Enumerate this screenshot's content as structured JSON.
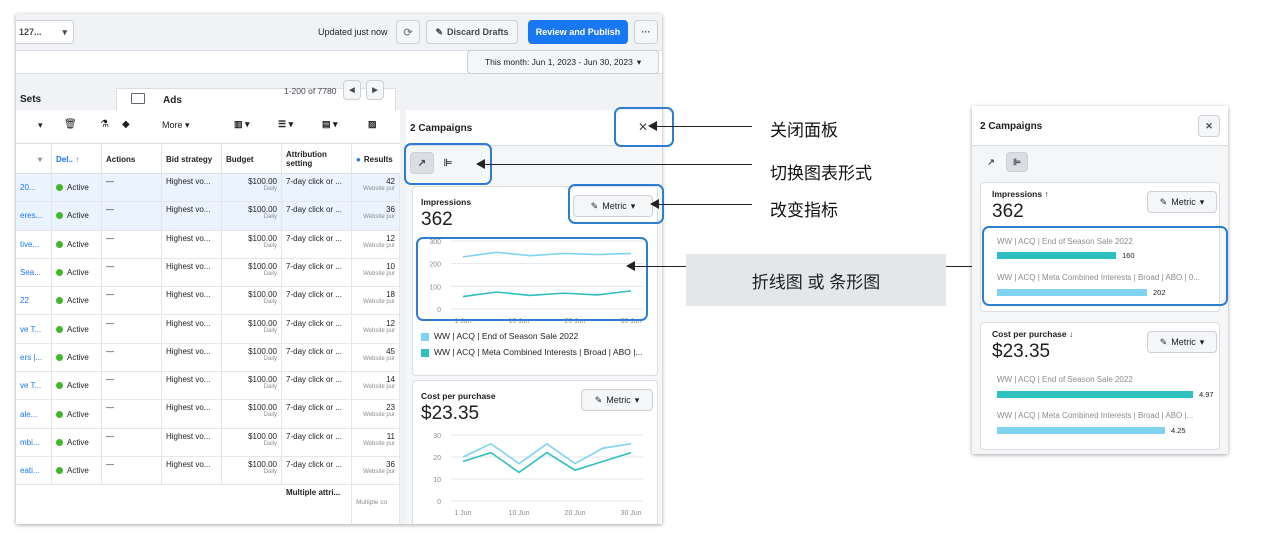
{
  "main": {
    "account_select": "127...",
    "updated_text": "Updated just now",
    "discard_label": "Discard Drafts",
    "publish_label": "Review and Publish",
    "more_label": "···",
    "date_range": "This month: Jun 1, 2023 - Jun 30, 2023",
    "tab_sets": "Sets",
    "tab_ads": "Ads",
    "pagination": "1-200 of 7780",
    "toolbar_more": "More",
    "columns": [
      "Del.. ↑",
      "Actions",
      "Bid strategy",
      "Budget",
      "Attribution setting",
      "Results"
    ],
    "rows": [
      {
        "name": "20...",
        "status": "Active",
        "actions": "—",
        "bid": "Highest vo...",
        "budget": "$100.00",
        "budget_sub": "Daily",
        "attr": "7-day click or ...",
        "result": "42",
        "result_sub": "Website pur"
      },
      {
        "name": "eres...",
        "status": "Active",
        "actions": "—",
        "bid": "Highest vo...",
        "budget": "$100.00",
        "budget_sub": "Daily",
        "attr": "7-day click or ...",
        "result": "36",
        "result_sub": "Website pur"
      },
      {
        "name": "tive...",
        "status": "Active",
        "actions": "—",
        "bid": "Highest vo...",
        "budget": "$100.00",
        "budget_sub": "Daily",
        "attr": "7-day click or ...",
        "result": "12",
        "result_sub": "Website pur"
      },
      {
        "name": "Sea...",
        "status": "Active",
        "actions": "—",
        "bid": "Highest vo...",
        "budget": "$100.00",
        "budget_sub": "Daily",
        "attr": "7-day click or ...",
        "result": "10",
        "result_sub": "Website pur"
      },
      {
        "name": "22",
        "status": "Active",
        "actions": "—",
        "bid": "Highest vo...",
        "budget": "$100.00",
        "budget_sub": "Daily",
        "attr": "7-day click or ...",
        "result": "18",
        "result_sub": "Website pur"
      },
      {
        "name": "ve T...",
        "status": "Active",
        "actions": "—",
        "bid": "Highest vo...",
        "budget": "$100.00",
        "budget_sub": "Daily",
        "attr": "7-day click or ...",
        "result": "12",
        "result_sub": "Website pur"
      },
      {
        "name": "ers |...",
        "status": "Active",
        "actions": "—",
        "bid": "Highest vo...",
        "budget": "$100.00",
        "budget_sub": "Daily",
        "attr": "7-day click or ...",
        "result": "45",
        "result_sub": "Website pur"
      },
      {
        "name": "ve T...",
        "status": "Active",
        "actions": "—",
        "bid": "Highest vo...",
        "budget": "$100.00",
        "budget_sub": "Daily",
        "attr": "7-day click or ...",
        "result": "14",
        "result_sub": "Website pur"
      },
      {
        "name": "ale...",
        "status": "Active",
        "actions": "—",
        "bid": "Highest vo...",
        "budget": "$100.00",
        "budget_sub": "Daily",
        "attr": "7-day click or ...",
        "result": "23",
        "result_sub": "Website pur"
      },
      {
        "name": "mbi...",
        "status": "Active",
        "actions": "—",
        "bid": "Highest vo...",
        "budget": "$100.00",
        "budget_sub": "Daily",
        "attr": "7-day click or ...",
        "result": "11",
        "result_sub": "Website pur"
      },
      {
        "name": "eati...",
        "status": "Active",
        "actions": "—",
        "bid": "Highest vo...",
        "budget": "$100.00",
        "budget_sub": "Daily",
        "attr": "7-day click or ...",
        "result": "36",
        "result_sub": "Website pur"
      }
    ],
    "summary_attr": "Multiple attri...",
    "summary_result": "Multiple co"
  },
  "panel": {
    "title": "2 Campaigns",
    "close": "✕",
    "metric_label": "Metric",
    "impressions_label": "Impressions",
    "impressions_value": "362",
    "cpp_label": "Cost per purchase",
    "cpp_value": "$23.35",
    "legend": [
      "WW | ACQ | End of Season Sale 2022",
      "WW | ACQ | Meta Combined Interests | Broad | ABO |..."
    ]
  },
  "chart_data": [
    {
      "type": "line",
      "title": "Impressions",
      "x": [
        "1 Jun",
        "10 Jun",
        "20 Jun",
        "30 Jun"
      ],
      "y_ticks": [
        0,
        100,
        200,
        300
      ],
      "ylim": [
        0,
        300
      ],
      "series": [
        {
          "name": "WW | ACQ | End of Season Sale 2022",
          "color": "#7fd3ef",
          "values": [
            230,
            250,
            235,
            245,
            240,
            245
          ]
        },
        {
          "name": "WW | ACQ | Meta Combined Interests | Broad | ABO |...",
          "color": "#2ebfbf",
          "values": [
            55,
            75,
            60,
            70,
            62,
            80
          ]
        }
      ]
    },
    {
      "type": "line",
      "title": "Cost per purchase",
      "x": [
        "1 Jun",
        "10 Jun",
        "20 Jun",
        "30 Jun"
      ],
      "y_ticks": [
        0,
        10,
        20,
        30
      ],
      "ylim": [
        0,
        30
      ],
      "series": [
        {
          "name": "WW | ACQ | End of Season Sale 2022",
          "color": "#7fd3ef",
          "values": [
            20,
            26,
            17,
            26,
            17,
            24,
            26
          ]
        },
        {
          "name": "WW | ACQ | Meta Combined Interests | Broad | ABO |...",
          "color": "#2ebfbf",
          "values": [
            18,
            22,
            13,
            22,
            14,
            18,
            22
          ]
        }
      ]
    },
    {
      "type": "bar",
      "title": "Impressions",
      "categories": [
        "WW | ACQ | End of Season Sale 2022",
        "WW | ACQ | Meta Combined Interests | Broad | ABO | 0..."
      ],
      "values": [
        160,
        202
      ]
    },
    {
      "type": "bar",
      "title": "Cost per purchase",
      "categories": [
        "WW | ACQ | End of Season Sale 2022",
        "WW | ACQ | Meta Combined Interests | Broad | ABO |..."
      ],
      "values": [
        4.97,
        4.25
      ]
    }
  ],
  "annotations": {
    "close_panel": "关闭面板",
    "switch_chart": "切换图表形式",
    "change_metric": "改变指标",
    "line_or_bar": "折线图 或 条形图"
  },
  "side": {
    "title": "2 Campaigns",
    "close": "✕",
    "impressions_label": "Impressions ↑",
    "impressions_value": "362",
    "cpp_label": "Cost per purchase ↓",
    "cpp_value": "$23.35",
    "metric_label": "Metric",
    "bar1_label": "WW | ACQ | End of Season Sale 2022",
    "bar2_label": "WW | ACQ | Meta Combined Interests | Broad | ABO | 0...",
    "bar3_label": "WW | ACQ | End of Season Sale 2022",
    "bar4_label": "WW | ACQ | Meta Combined Interests | Broad | ABO |...",
    "bar1_value": "160",
    "bar2_value": "202",
    "bar3_value": "4.97",
    "bar4_value": "4.25",
    "color_a": "#2ebfbf",
    "color_b": "#7fd3ef"
  }
}
